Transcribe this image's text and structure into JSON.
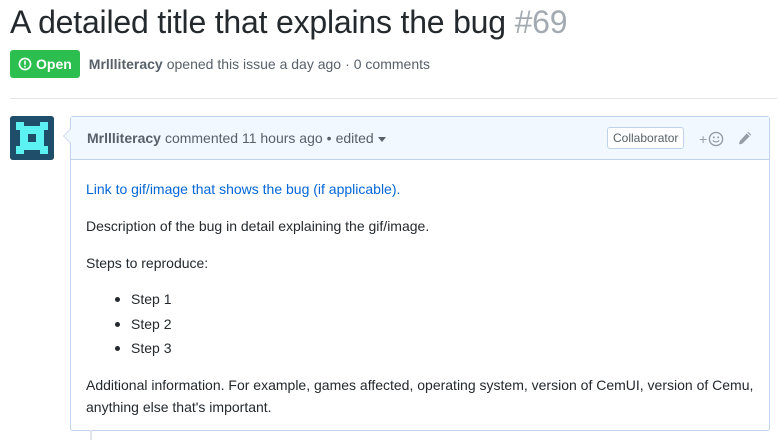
{
  "issue": {
    "title": "A detailed title that explains the bug",
    "number": "#69",
    "state_label": "Open",
    "author": "Mrllliteracy",
    "opened_text": "opened this issue a day ago",
    "separator": "·",
    "comments_count": "0 comments"
  },
  "comment": {
    "author": "Mrllliteracy",
    "commented_text": "commented 11 hours ago",
    "bullet_sep": "•",
    "edited_label": "edited",
    "role_badge": "Collaborator",
    "reaction_plus": "+",
    "body": {
      "link_text": "Link to gif/image that shows the bug (if applicable).",
      "description": "Description of the bug in detail explaining the gif/image.",
      "steps_heading": "Steps to reproduce:",
      "steps": [
        "Step 1",
        "Step 2",
        "Step 3"
      ],
      "additional": "Additional information. For example, games affected, operating system, version of CemUI, version of Cemu, anything else that's important."
    }
  },
  "colors": {
    "open_badge": "#2cbe4e",
    "link": "#0366d6",
    "header_bg": "#f1f8ff",
    "border": "#c0d3eb"
  },
  "icons": {
    "state": "issue-opened-icon",
    "reaction": "smiley-icon",
    "edit": "pencil-icon",
    "avatar": "identicon-avatar"
  }
}
